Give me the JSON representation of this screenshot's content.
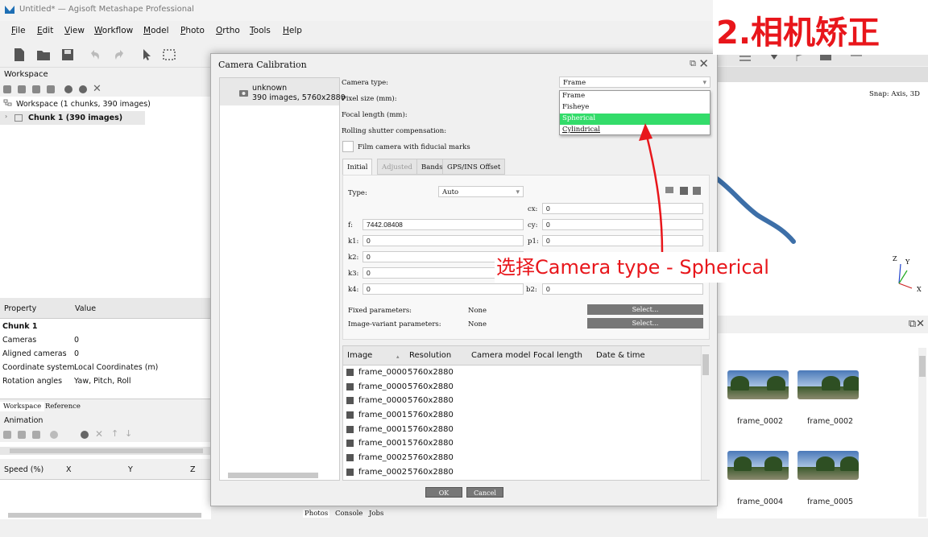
{
  "window": {
    "title": "Untitled* — Agisoft Metashape Professional"
  },
  "menu": [
    "File",
    "Edit",
    "View",
    "Workflow",
    "Model",
    "Photo",
    "Ortho",
    "Tools",
    "Help"
  ],
  "workspace": {
    "header": "Workspace",
    "root": "Workspace (1 chunks, 390 images)",
    "chunk": "Chunk 1 (390 images)"
  },
  "properties": {
    "col_property": "Property",
    "col_value": "Value",
    "group": "Chunk 1",
    "rows": [
      {
        "name": "Cameras",
        "value": "0"
      },
      {
        "name": "Aligned cameras",
        "value": "0"
      },
      {
        "name": "Coordinate system",
        "value": "Local Coordinates (m)"
      },
      {
        "name": "Rotation angles",
        "value": "Yaw, Pitch, Roll"
      }
    ]
  },
  "left_tabs": [
    "Workspace",
    "Reference"
  ],
  "animation": {
    "header": "Animation",
    "cols": [
      "Speed (%)",
      "X",
      "Y",
      "Z"
    ]
  },
  "view3d": {
    "snap": "Snap: Axis, 3D",
    "axis_x": "X",
    "axis_y": "Y",
    "axis_z": "Z"
  },
  "photos": {
    "thumbs": [
      "frame_0002",
      "frame_0002",
      "frame_0004",
      "frame_0005"
    ]
  },
  "bottom_tabs": [
    "Photos",
    "Console",
    "Jobs"
  ],
  "dialog": {
    "title": "Camera Calibration",
    "camera_group": {
      "name": "unknown",
      "info": "390 images, 5760x2880"
    },
    "labels": {
      "camera_type": "Camera type:",
      "pixel_size": "Pixel size (mm):",
      "focal_length": "Focal length (mm):",
      "rolling": "Rolling shutter compensation:",
      "film": "Film camera with fiducial marks",
      "type": "Type:",
      "fixed": "Fixed parameters:",
      "image_variant": "Image-variant parameters:"
    },
    "camera_type_value": "Frame",
    "dropdown_options": [
      "Frame",
      "Fisheye",
      "Spherical",
      "Cylindrical"
    ],
    "dropdown_selected": "Spherical",
    "subtabs": [
      "Initial",
      "Adjusted",
      "Bands",
      "GPS/INS Offset"
    ],
    "type_value": "Auto",
    "params": {
      "f_label": "f:",
      "f": "7442.08408",
      "cx_label": "cx:",
      "cx": "0",
      "cy_label": "cy:",
      "cy": "0",
      "k1_label": "k1:",
      "k1": "0",
      "k2_label": "k2:",
      "k2": "0",
      "k3_label": "k3:",
      "k3": "0",
      "k4_label": "k4:",
      "k4": "0",
      "p1_label": "p1:",
      "p1": "0",
      "b2_label": "b2:",
      "b2": "0"
    },
    "fixed_value": "None",
    "image_variant_value": "None",
    "select_btn": "Select...",
    "table": {
      "cols": [
        "Image",
        "Resolution",
        "Camera model",
        "Focal length",
        "Date & time"
      ],
      "rows": [
        {
          "name": "frame_0000",
          "res": "5760x2880"
        },
        {
          "name": "frame_0000",
          "res": "5760x2880"
        },
        {
          "name": "frame_0000",
          "res": "5760x2880"
        },
        {
          "name": "frame_0001",
          "res": "5760x2880"
        },
        {
          "name": "frame_0001",
          "res": "5760x2880"
        },
        {
          "name": "frame_0001",
          "res": "5760x2880"
        },
        {
          "name": "frame_0002",
          "res": "5760x2880"
        },
        {
          "name": "frame_0002",
          "res": "5760x2880"
        }
      ]
    },
    "ok": "OK",
    "cancel": "Cancel"
  },
  "overlay": {
    "step_title": "2.相机矫正",
    "annotation": "选择Camera type - Spherical",
    "color": "#e8161b"
  }
}
